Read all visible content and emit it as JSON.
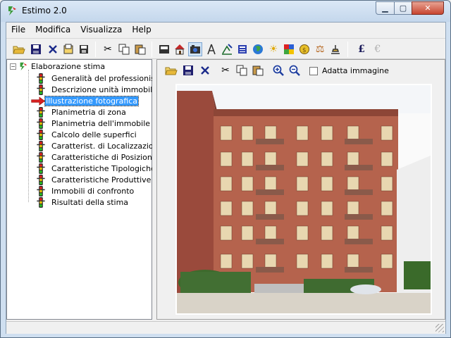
{
  "window": {
    "title": "Estimo 2.0"
  },
  "menu": {
    "items": [
      "File",
      "Modifica",
      "Visualizza",
      "Help"
    ]
  },
  "toolbar": {
    "icons": [
      "open-folder-icon",
      "save-icon",
      "delete-icon",
      "import-icon",
      "export-icon",
      "cut-icon",
      "copy-icon",
      "paste-icon",
      "printer-icon",
      "house-icon",
      "camera-icon",
      "compass-icon",
      "drawing-icon",
      "calculator-icon",
      "globe-icon",
      "sun-icon",
      "grid-icon",
      "coin-icon",
      "scale-icon",
      "stamp-icon",
      "pound-icon",
      "euro-icon"
    ],
    "currency_pound": "£",
    "currency_euro": "€"
  },
  "tree": {
    "root_label": "Elaborazione stima",
    "items": [
      {
        "label": "Generalità del professionista",
        "icon": "traffic-light-icon"
      },
      {
        "label": "Descrizione unità immobiliare",
        "icon": "traffic-light-icon"
      },
      {
        "label": "Illustrazione fotografica",
        "icon": "red-arrow-icon",
        "selected": true
      },
      {
        "label": "Planimetria di zona",
        "icon": "traffic-light-icon"
      },
      {
        "label": "Planimetria dell'immobile",
        "icon": "traffic-light-icon"
      },
      {
        "label": "Calcolo delle superfici",
        "icon": "traffic-light-icon"
      },
      {
        "label": "Caratterist. di Localizzazione",
        "icon": "traffic-light-icon"
      },
      {
        "label": "Caratteristiche di Posizione",
        "icon": "traffic-light-icon"
      },
      {
        "label": "Caratteristiche Tipologiche",
        "icon": "traffic-light-icon"
      },
      {
        "label": "Caratteristiche Produttive",
        "icon": "traffic-light-icon"
      },
      {
        "label": "Immobili di confronto",
        "icon": "traffic-light-icon"
      },
      {
        "label": "Risultati della stima",
        "icon": "traffic-light-icon"
      }
    ]
  },
  "image_panel": {
    "tools": [
      "open-folder-icon",
      "save-icon",
      "delete-icon",
      "cut-icon",
      "copy-icon",
      "paste-icon",
      "zoom-in-icon",
      "zoom-out-icon"
    ],
    "fit_checkbox_label": "Adatta immagine",
    "fit_checked": false
  },
  "colors": {
    "selection": "#3399ff",
    "titlebar": "#c4d7ec"
  }
}
